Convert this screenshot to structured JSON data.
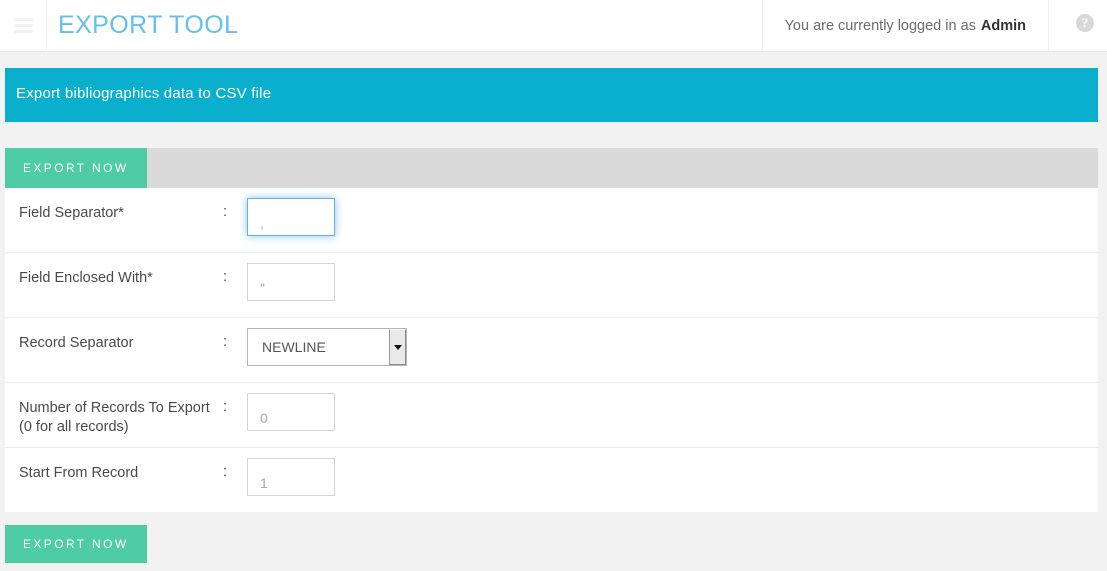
{
  "header": {
    "menu_icon": "hamburger-menu-icon",
    "app_title": "EXPORT TOOL",
    "logged_in_prefix": "You are currently logged in as",
    "username": "Admin",
    "help_icon": "?",
    "title_color": "#63c0e8"
  },
  "banner": {
    "text": "Export bibliographics data to CSV file",
    "color": "#0aafcd"
  },
  "toolbar": {
    "export_label": "EXPORT NOW",
    "button_color": "#4ecca3"
  },
  "form": {
    "colon": ":",
    "rows": [
      {
        "label": "Field Separator*",
        "type": "text",
        "value": ",",
        "focused": true
      },
      {
        "label": "Field Enclosed With*",
        "type": "text",
        "value": "\"",
        "focused": false
      },
      {
        "label": "Record Separator",
        "type": "select",
        "value": "NEWLINE",
        "options": [
          "NEWLINE"
        ]
      },
      {
        "label": "Number of Records To Export (0 for all records)",
        "type": "text",
        "value": "0",
        "focused": false
      },
      {
        "label": "Start From Record",
        "type": "text",
        "value": "1",
        "focused": false
      }
    ]
  },
  "footer": {
    "export_label": "EXPORT NOW"
  }
}
